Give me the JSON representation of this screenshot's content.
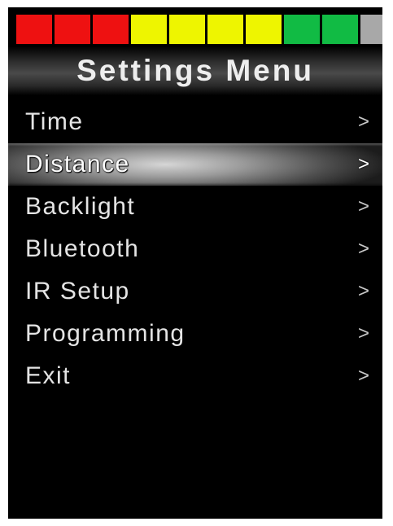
{
  "battery": {
    "segments": [
      {
        "color": "#ee1111"
      },
      {
        "color": "#ee1111"
      },
      {
        "color": "#ee1111"
      },
      {
        "color": "#eef500"
      },
      {
        "color": "#eef500"
      },
      {
        "color": "#eef500"
      },
      {
        "color": "#eef500"
      },
      {
        "color": "#11bb44"
      },
      {
        "color": "#11bb44"
      },
      {
        "color": "#a8a8a8"
      }
    ]
  },
  "header": {
    "title": "Settings Menu"
  },
  "menu": {
    "selected_index": 1,
    "items": [
      {
        "label": "Time",
        "icon": "chevron-right",
        "chevron": ">"
      },
      {
        "label": "Distance",
        "icon": "chevron-right",
        "chevron": ">"
      },
      {
        "label": "Backlight",
        "icon": "chevron-right",
        "chevron": ">"
      },
      {
        "label": "Bluetooth",
        "icon": "chevron-right",
        "chevron": ">"
      },
      {
        "label": "IR Setup",
        "icon": "chevron-right",
        "chevron": ">"
      },
      {
        "label": "Programming",
        "icon": "chevron-right",
        "chevron": ">"
      },
      {
        "label": "Exit",
        "icon": "chevron-right",
        "chevron": ">"
      }
    ]
  }
}
